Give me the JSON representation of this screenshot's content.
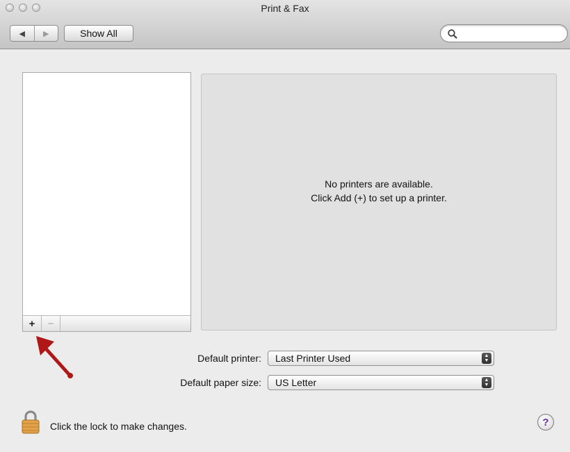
{
  "window": {
    "title": "Print & Fax"
  },
  "toolbar": {
    "back_icon": "back-arrow-icon",
    "forward_icon": "forward-arrow-icon",
    "show_all_label": "Show All",
    "search": {
      "value": "",
      "placeholder": "",
      "icon": "magnifier-icon"
    }
  },
  "printer_list": {
    "items": [],
    "add_label": "+",
    "remove_label": "−"
  },
  "details": {
    "message_line1": "No printers are available.",
    "message_line2": "Click Add (+) to set up a printer."
  },
  "defaults": {
    "printer_label": "Default printer:",
    "printer_value": "Last Printer Used",
    "paper_label": "Default paper size:",
    "paper_value": "US Letter"
  },
  "footer": {
    "lock_text": "Click the lock to make changes.",
    "help_label": "?"
  },
  "colors": {
    "annotation_arrow": "#b01818",
    "help_glyph": "#6a2ea5"
  }
}
